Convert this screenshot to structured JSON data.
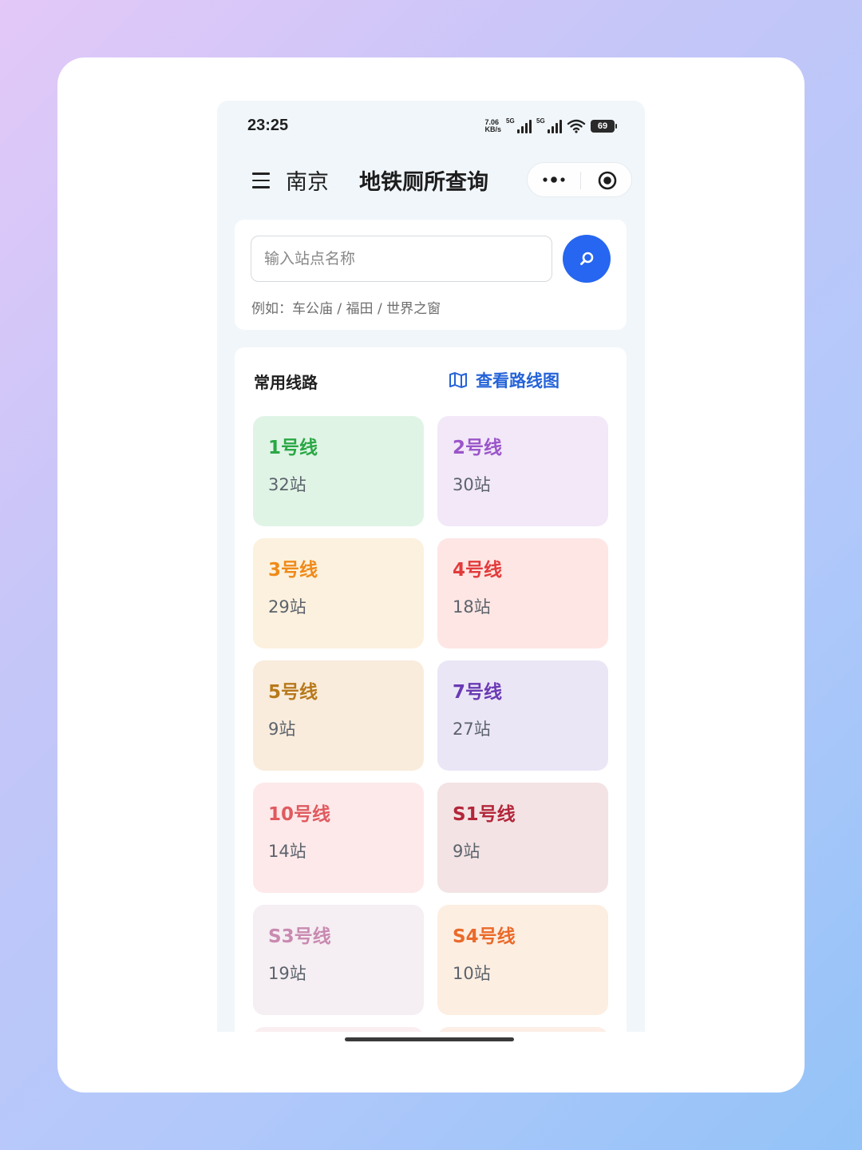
{
  "status": {
    "time": "23:25",
    "net_speed_top": "7.06",
    "net_speed_bottom": "KB/s",
    "sim1_tag": "5G",
    "sim2_tag": "5G",
    "battery": "69"
  },
  "header": {
    "city": "南京",
    "title": "地铁厕所查询"
  },
  "search": {
    "placeholder": "输入站点名称",
    "hint": "例如：车公庙 / 福田 / 世界之窗"
  },
  "lines_section": {
    "title": "常用线路",
    "map_link": "查看路线图"
  },
  "lines": [
    {
      "name": "1号线",
      "count": "32站",
      "color": "#2aa845",
      "bg": "#e0f4e6"
    },
    {
      "name": "2号线",
      "count": "30站",
      "color": "#9b55c9",
      "bg": "#f2e8f8"
    },
    {
      "name": "3号线",
      "count": "29站",
      "color": "#ef8a18",
      "bg": "#fcf1de"
    },
    {
      "name": "4号线",
      "count": "18站",
      "color": "#e23b3b",
      "bg": "#fde6e4"
    },
    {
      "name": "5号线",
      "count": "9站",
      "color": "#b8791b",
      "bg": "#f9ecdc"
    },
    {
      "name": "7号线",
      "count": "27站",
      "color": "#6a3ab4",
      "bg": "#ebe6f6"
    },
    {
      "name": "10号线",
      "count": "14站",
      "color": "#e05a5f",
      "bg": "#fde9ea"
    },
    {
      "name": "S1号线",
      "count": "9站",
      "color": "#b3263a",
      "bg": "#f3e3e4"
    },
    {
      "name": "S3号线",
      "count": "19站",
      "color": "#c98ab0",
      "bg": "#f5eef3"
    },
    {
      "name": "S4号线",
      "count": "10站",
      "color": "#ea6a2a",
      "bg": "#fdeee2"
    }
  ],
  "icons": {
    "menu": "menu-icon",
    "more": "more-dots-icon",
    "target": "record-target-icon",
    "search": "search-icon",
    "map": "map-icon"
  }
}
